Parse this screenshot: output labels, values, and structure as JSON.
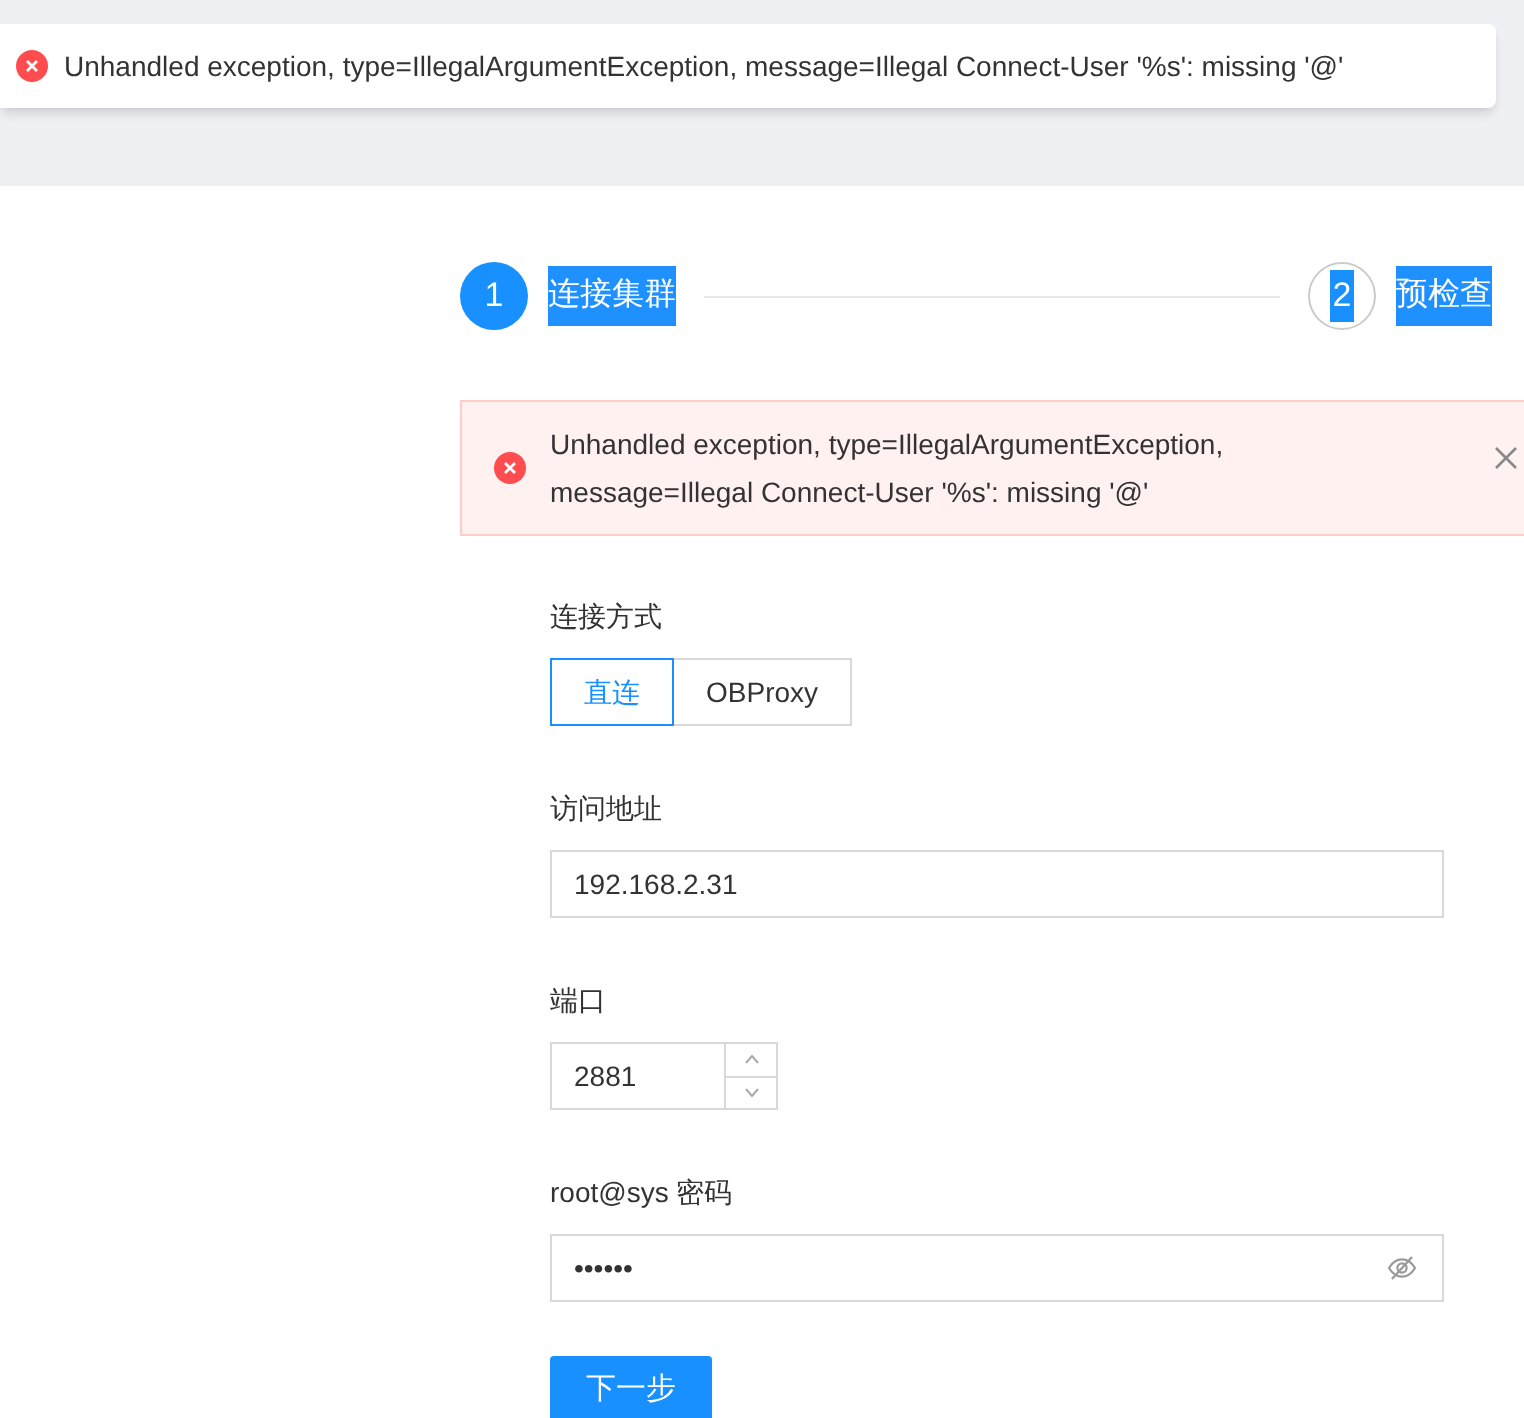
{
  "toast": {
    "message": "Unhandled exception, type=IllegalArgumentException, message=Illegal Connect-User '%s': missing '@'"
  },
  "steps": [
    {
      "number": "1",
      "label": "连接集群",
      "selected": true
    },
    {
      "number": "2",
      "label": "预检查",
      "selected": false
    }
  ],
  "alert": {
    "message": "Unhandled exception, type=IllegalArgumentException, message=Illegal Connect-User '%s': missing '@'"
  },
  "form": {
    "connection_mode": {
      "label": "连接方式",
      "options": [
        {
          "label": "直连",
          "selected": true
        },
        {
          "label": "OBProxy",
          "selected": false
        }
      ]
    },
    "address": {
      "label": "访问地址",
      "value": "192.168.2.31"
    },
    "port": {
      "label": "端口",
      "value": "2881"
    },
    "password": {
      "label": "root@sys 密码",
      "value": "••••••"
    },
    "submit": "下一步"
  }
}
